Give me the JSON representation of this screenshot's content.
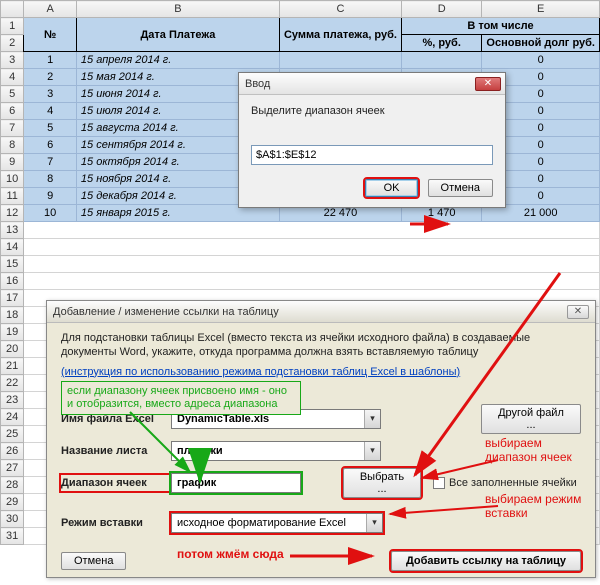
{
  "columns": [
    "A",
    "B",
    "C",
    "D",
    "E"
  ],
  "rownums": [
    "1",
    "2",
    "3",
    "4",
    "5",
    "6",
    "7",
    "8",
    "9",
    "10",
    "11",
    "12",
    "13",
    "14",
    "15",
    "16",
    "17",
    "18",
    "19",
    "20",
    "21",
    "22",
    "23",
    "24",
    "25",
    "26",
    "27",
    "28",
    "29",
    "30",
    "31"
  ],
  "table": {
    "hdr_no": "№",
    "hdr_date": "Дата Платежа",
    "hdr_sum": "Сумма платежа, руб.",
    "hdr_group": "В том числе",
    "hdr_pct": "%, руб.",
    "hdr_main": "Основной долг руб.",
    "rows": [
      {
        "n": "1",
        "date": "15 апреля 2014 г.",
        "e": "0"
      },
      {
        "n": "2",
        "date": "15 мая 2014 г.",
        "e": "0"
      },
      {
        "n": "3",
        "date": "15 июня 2014 г.",
        "e": "0"
      },
      {
        "n": "4",
        "date": "15 июля 2014 г.",
        "e": "0"
      },
      {
        "n": "5",
        "date": "15 августа 2014 г.",
        "e": "0"
      },
      {
        "n": "6",
        "date": "15 сентября 2014 г.",
        "e": "0"
      },
      {
        "n": "7",
        "date": "15 октября 2014 г.",
        "e": "0"
      },
      {
        "n": "8",
        "date": "15 ноября 2014 г.",
        "e": "0"
      },
      {
        "n": "9",
        "date": "15 декабря 2014 г.",
        "c": "",
        "d": "",
        "e": "0"
      },
      {
        "n": "10",
        "date": "15 января 2015 г.",
        "c": "22 470",
        "d": "1 470",
        "e": "21 000"
      }
    ]
  },
  "input_dlg": {
    "title": "Ввод",
    "prompt": "Выделите диапазон ячеек",
    "value": "$A$1:$E$12",
    "ok": "OK",
    "cancel": "Отмена"
  },
  "form": {
    "title": "Добавление / изменение ссылки на таблицу",
    "help1": "Для подстановки таблицы Excel (вместо текста из ячейки исходного файла) в создаваемые документы Word, укажите, откуда программа должна взять вставляемую таблицу",
    "help_link": "(инструкция по использованию режима подстановки таблиц Excel в шаблоны)",
    "hint_green": "если диапазону ячеек присвоено имя - оно и отобразится, вместо адреса диапазона",
    "lbl_file": "Имя файла Excel",
    "val_file": "DynamicTable.xls",
    "btn_otherfile": "Другой файл ...",
    "lbl_sheet": "Название листа",
    "val_sheet": "платежи",
    "lbl_range": "Диапазон ячеек",
    "val_range": "график",
    "btn_select": "Выбрать ...",
    "chk_all": "Все заполненные ячейки",
    "lbl_mode": "Режим вставки",
    "val_mode": "исходное форматирование Excel",
    "btn_cancel": "Отмена",
    "btn_add": "Добавить ссылку на таблицу",
    "anno_range": "выбираем диапазон ячеек",
    "anno_mode": "выбираем режим вставки",
    "anno_press": "потом жмём сюда"
  }
}
